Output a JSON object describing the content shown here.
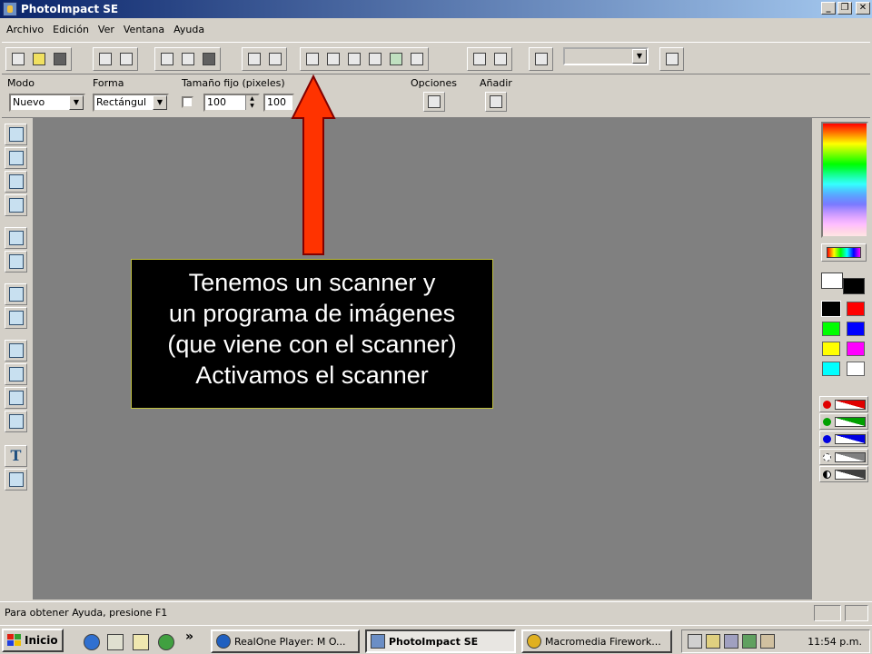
{
  "window": {
    "title": "PhotoImpact SE"
  },
  "menu": [
    "Archivo",
    "Edición",
    "Ver",
    "Ventana",
    "Ayuda"
  ],
  "properties": {
    "modo_label": "Modo",
    "modo_value": "Nuevo",
    "forma_label": "Forma",
    "forma_value": "Rectángul",
    "tamano_label": "Tamaño fijo (pixeles)",
    "width_value": "100",
    "height_value": "100",
    "opciones_label": "Opciones",
    "anadir_label": "Añadir"
  },
  "callout": {
    "line1": "Tenemos un scanner y",
    "line2": "un programa de imágenes",
    "line3": "(que viene con el scanner)",
    "line4": "Activamos el scanner"
  },
  "status": {
    "text": "Para obtener Ayuda, presione F1"
  },
  "taskbar": {
    "start_label": "Inicio",
    "chevron": "»",
    "tasks": [
      "RealOne Player: M O...",
      "PhotoImpact SE",
      "Macromedia Firework..."
    ],
    "clock": "11:54 p.m."
  },
  "colors": {
    "arrow": "#ff3300",
    "workspace": "#808080",
    "titlebar": "#0a246a",
    "palette": [
      "#000000",
      "#ff0000",
      "#00ff00",
      "#0000ff",
      "#ffff00",
      "#ff00ff",
      "#00ffff",
      "#ffffff"
    ]
  }
}
